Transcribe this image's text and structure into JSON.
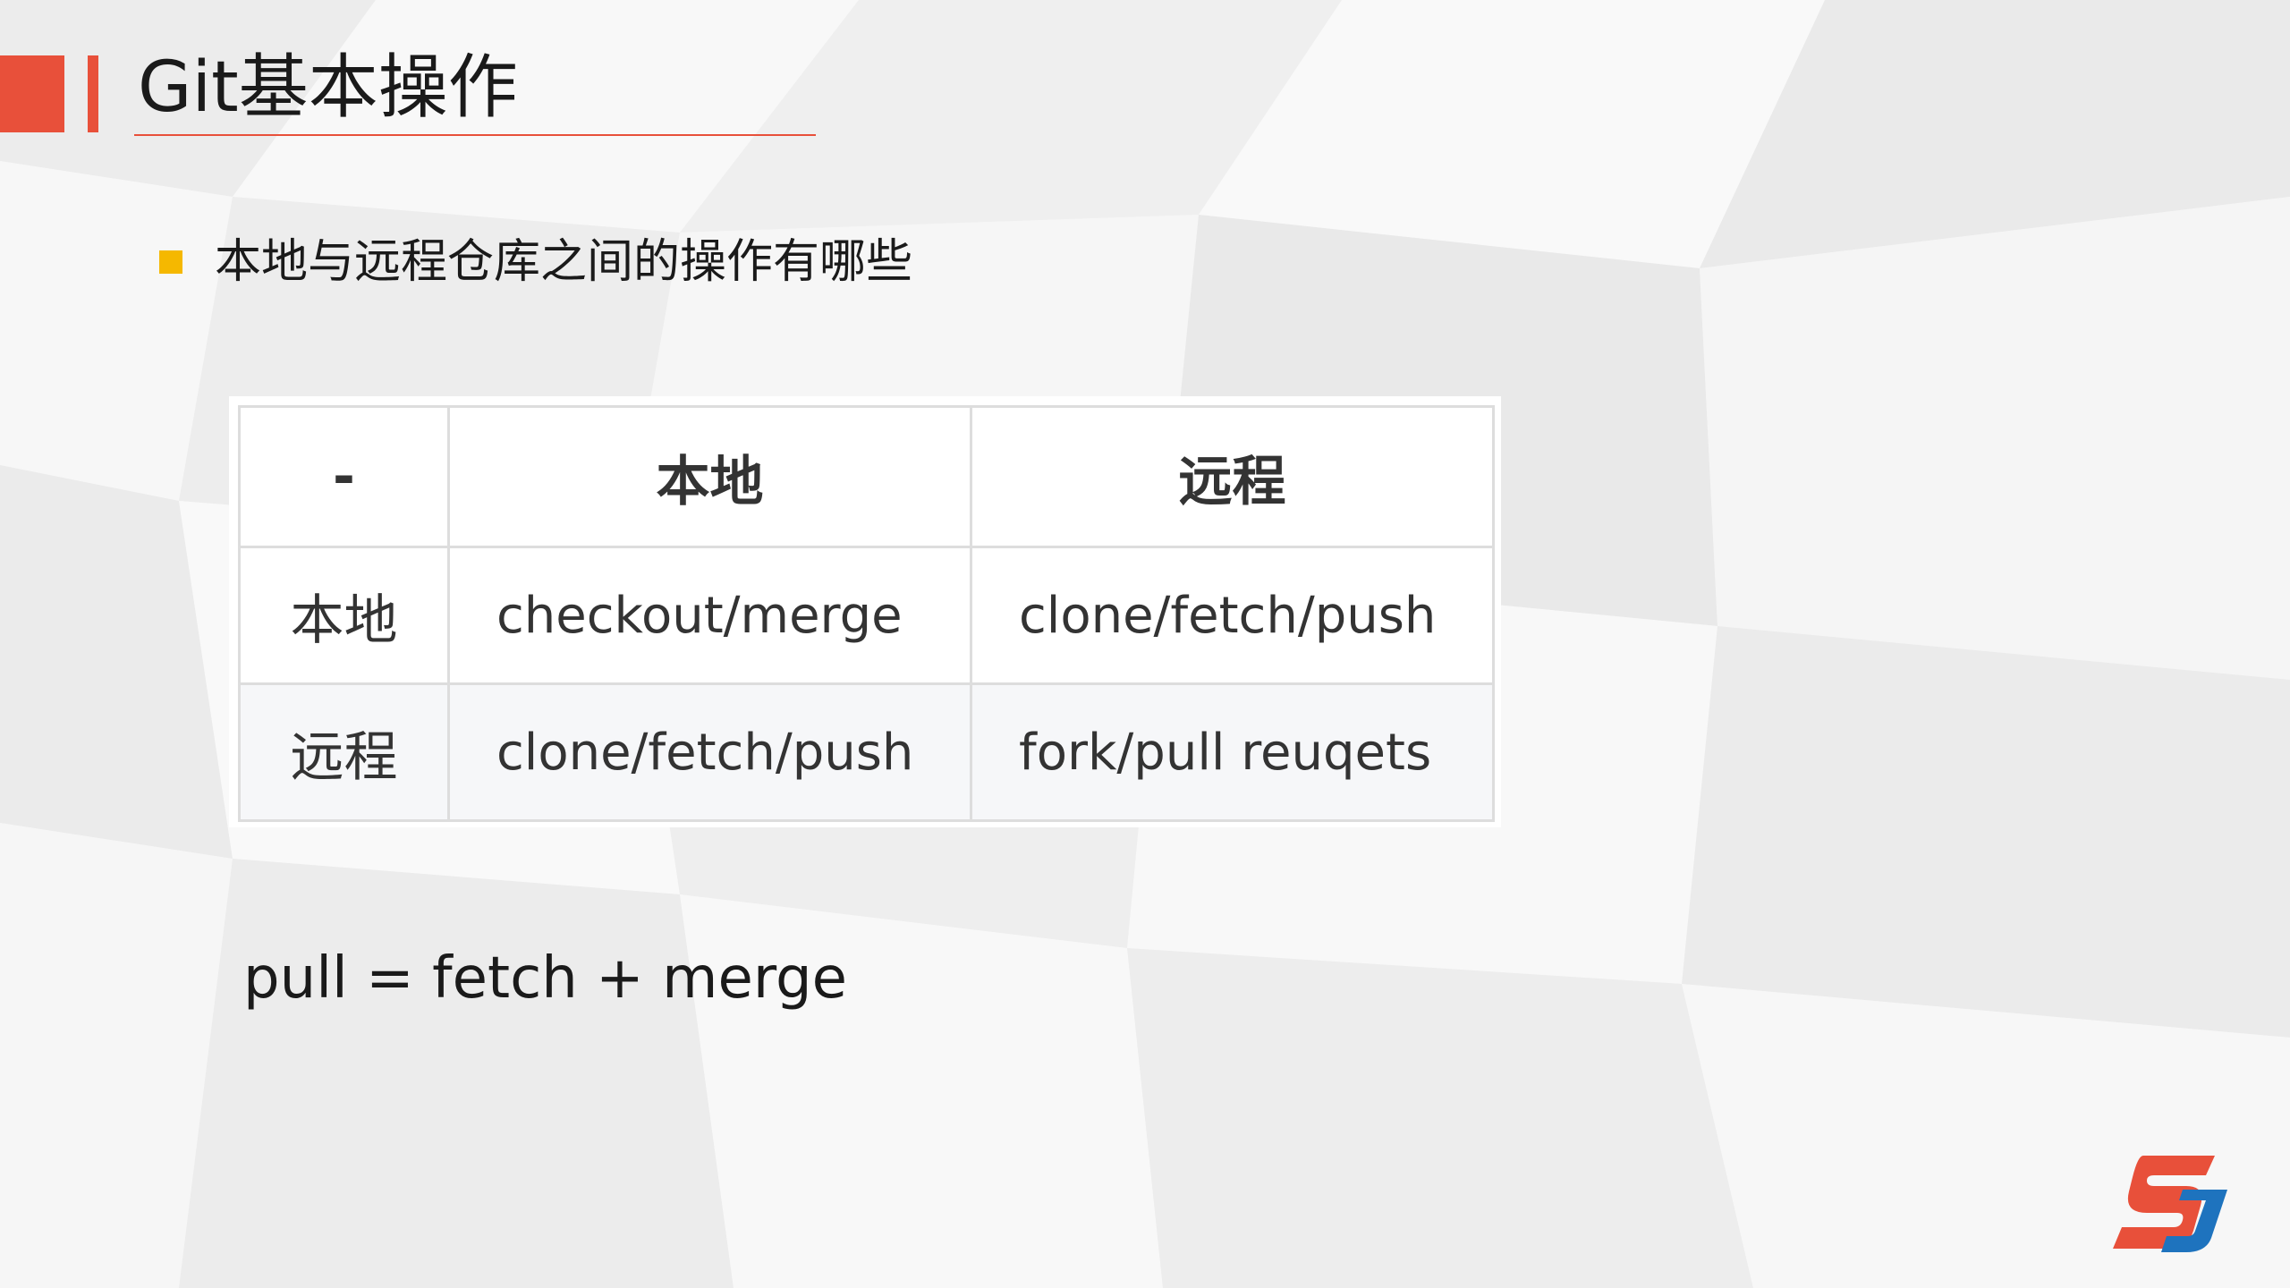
{
  "slide": {
    "title": "Git基本操作",
    "bullet_text": "本地与远程仓库之间的操作有哪些",
    "formula": "pull = fetch + merge"
  },
  "table": {
    "headers": [
      "-",
      "本地",
      "远程"
    ],
    "rows": [
      [
        "本地",
        "checkout/merge",
        "clone/fetch/push"
      ],
      [
        "远程",
        "clone/fetch/push",
        "fork/pull reuqets"
      ]
    ]
  },
  "colors": {
    "accent_red": "#e8503a",
    "bullet_yellow": "#f5b800",
    "table_border": "#dddddd",
    "table_text": "#333333"
  },
  "icons": {
    "bullet": "square-bullet-icon",
    "logo": "brand-logo-icon"
  }
}
